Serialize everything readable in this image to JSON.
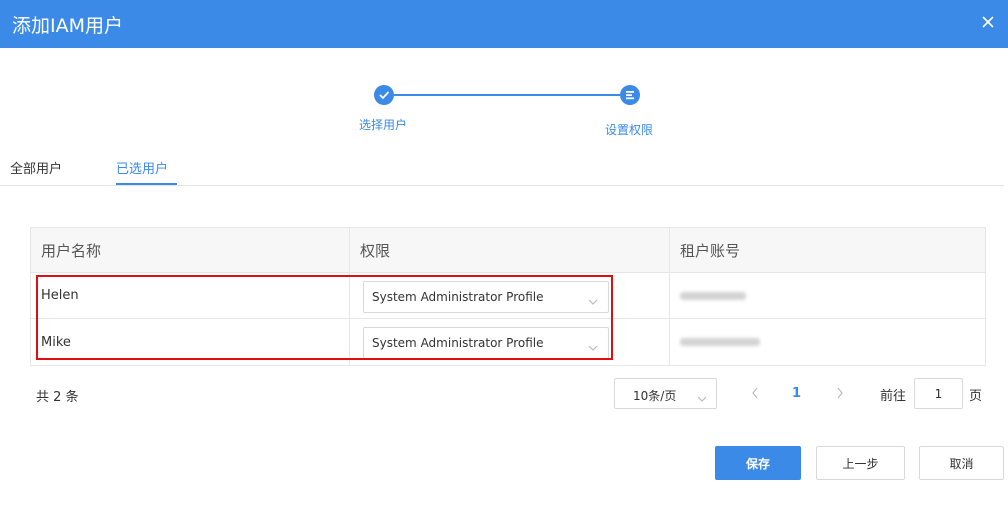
{
  "dialog": {
    "title": "添加IAM用户"
  },
  "stepper": {
    "steps": [
      {
        "label": "选择用户",
        "state": "done",
        "icon": "check-icon"
      },
      {
        "label": "设置权限",
        "state": "current",
        "icon": "list-icon"
      }
    ]
  },
  "tabs": [
    {
      "label": "全部用户",
      "active": false
    },
    {
      "label": "已选用户",
      "active": true
    }
  ],
  "table": {
    "headers": [
      "用户名称",
      "权限",
      "租户账号"
    ],
    "rows": [
      {
        "name": "Helen",
        "permission": "System Administrator Profile",
        "tenant": ""
      },
      {
        "name": "Mike",
        "permission": "System Administrator Profile",
        "tenant": ""
      }
    ]
  },
  "pagination": {
    "total": "共 2 条",
    "page_size": "10条/页",
    "current_page": "1",
    "goto_label": "前往",
    "goto_value": "1",
    "page_suffix": "页"
  },
  "footer": {
    "save": "保存",
    "prev": "上一步",
    "cancel": "取消"
  },
  "colors": {
    "accent": "#3b8ae8",
    "highlight": "#e00f0f"
  }
}
